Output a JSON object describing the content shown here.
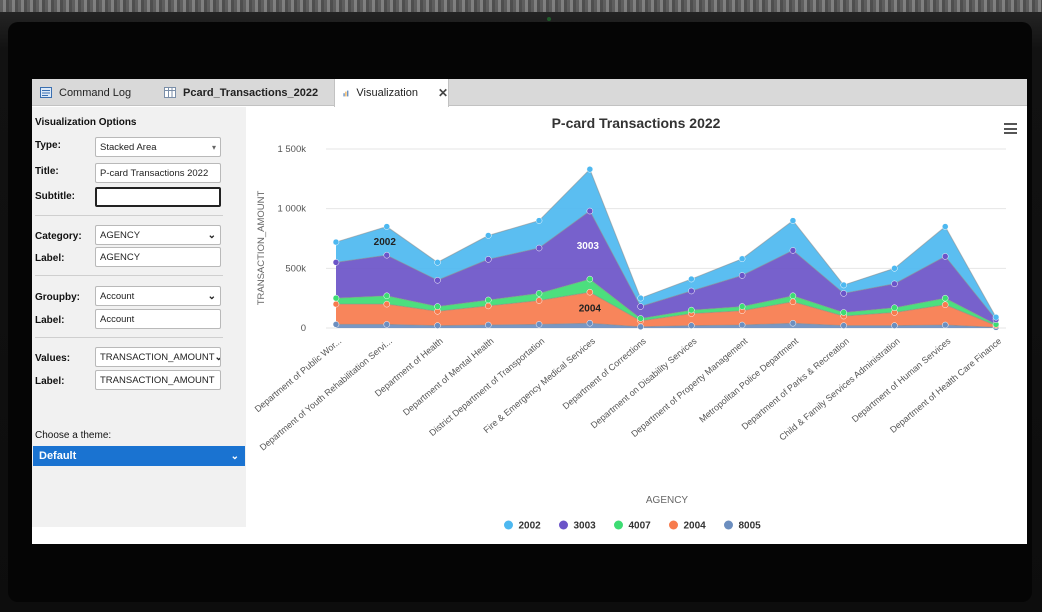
{
  "tabs": [
    {
      "label": "Command Log",
      "icon": "log-icon",
      "active": false
    },
    {
      "label": "Pcard_Transactions_2022",
      "icon": "table-icon",
      "active": false
    },
    {
      "label": "Visualization",
      "icon": "bar-chart-icon",
      "active": true
    }
  ],
  "panel": {
    "title": "Visualization Options",
    "type_label": "Type:",
    "type_value": "Stacked Area",
    "title_label": "Title:",
    "title_value": "P-card Transactions 2022",
    "subtitle_label": "Subtitle:",
    "subtitle_value": "",
    "category_label": "Category:",
    "category_value": "AGENCY",
    "category_label_label": "Label:",
    "category_label_value": "AGENCY",
    "groupby_label": "Groupby:",
    "groupby_value": "Account",
    "groupby_label_label": "Label:",
    "groupby_label_value": "Account",
    "values_label": "Values:",
    "values_value": "TRANSACTION_AMOUNT",
    "values_label_label": "Label:",
    "values_label_value": "TRANSACTION_AMOUNT",
    "theme_label": "Choose a theme:",
    "theme_value": "Default"
  },
  "chart_data": {
    "type": "area",
    "stacked": true,
    "title": "P-card Transactions 2022",
    "xlabel": "AGENCY",
    "ylabel": "TRANSACTION_AMOUNT",
    "ylim": [
      0,
      1500000
    ],
    "y_ticks": [
      0,
      500000,
      1000000,
      1500000
    ],
    "y_tick_labels": [
      "0",
      "500k",
      "1 000k",
      "1 500k"
    ],
    "grid": true,
    "legend_position": "bottom-center",
    "categories": [
      "Department of Public Wor...",
      "Department of Youth Rehabilitation Servi...",
      "Department of Health",
      "Department of Mental Health",
      "District Department of Transportation",
      "Fire & Emergency Medical Services",
      "Department of Corrections",
      "Department on Disability Services",
      "Department of Property Management",
      "Metropolitan Police Department",
      "Department of Parks & Recreation",
      "Child & Family Services Administration",
      "Department of Human Services",
      "Department of Health Care Finance"
    ],
    "series": [
      {
        "name": "8005",
        "color": "#6c8ebf",
        "values": [
          30000,
          30000,
          20000,
          25000,
          30000,
          40000,
          10000,
          20000,
          25000,
          40000,
          20000,
          20000,
          25000,
          5000
        ]
      },
      {
        "name": "2004",
        "color": "#f77b4d",
        "values": [
          170000,
          170000,
          120000,
          160000,
          200000,
          260000,
          50000,
          100000,
          120000,
          180000,
          80000,
          110000,
          170000,
          15000
        ]
      },
      {
        "name": "4007",
        "color": "#3ddc73",
        "values": [
          50000,
          70000,
          40000,
          50000,
          60000,
          110000,
          20000,
          30000,
          35000,
          50000,
          30000,
          40000,
          55000,
          10000
        ]
      },
      {
        "name": "3003",
        "color": "#6b54c8",
        "values": [
          300000,
          340000,
          220000,
          340000,
          380000,
          570000,
          100000,
          160000,
          260000,
          380000,
          160000,
          200000,
          350000,
          40000
        ]
      },
      {
        "name": "2002",
        "color": "#4db8f0",
        "values": [
          170000,
          240000,
          150000,
          200000,
          230000,
          350000,
          70000,
          100000,
          140000,
          250000,
          70000,
          130000,
          250000,
          20000
        ]
      }
    ],
    "legend_order": [
      "2002",
      "3003",
      "4007",
      "2004",
      "8005"
    ],
    "annotations": [
      {
        "text": "2002",
        "category_index": 1,
        "series": "2002"
      },
      {
        "text": "3003",
        "category_index": 5,
        "series": "3003"
      },
      {
        "text": "2004",
        "category_index": 5,
        "series": "2004"
      }
    ]
  }
}
